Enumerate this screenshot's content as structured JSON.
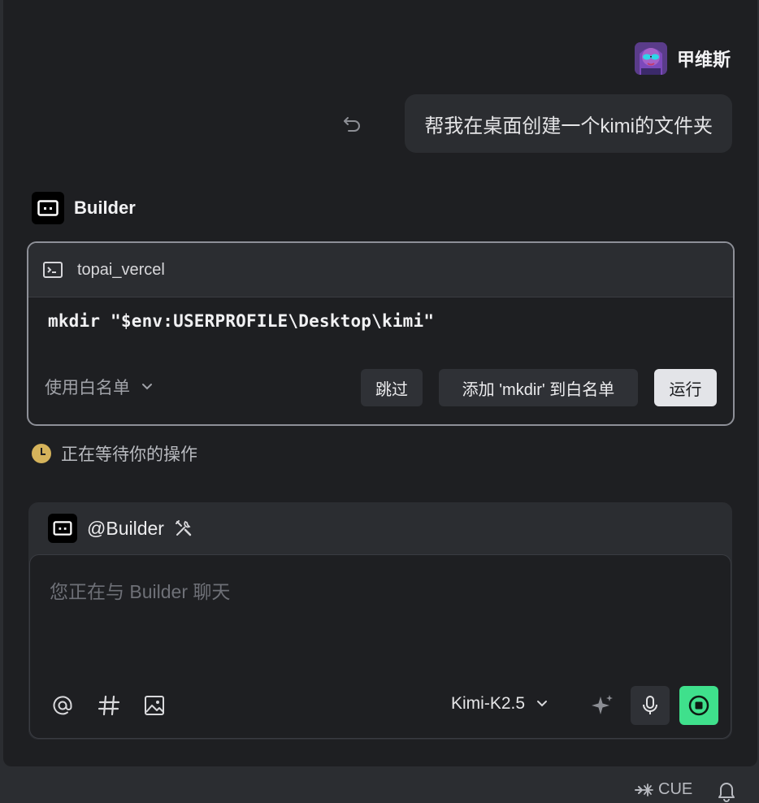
{
  "user": {
    "name": "甲维斯",
    "message": "帮我在桌面创建一个kimi的文件夹"
  },
  "assistant": {
    "name": "Builder"
  },
  "command_card": {
    "tool_name": "topai_vercel",
    "command": "mkdir \"$env:USERPROFILE\\Desktop\\kimi\"",
    "whitelist_select": "使用白名单",
    "skip_label": "跳过",
    "add_whitelist_label": "添加 'mkdir' 到白名单",
    "run_label": "运行"
  },
  "status": {
    "waiting_text": "正在等待你的操作"
  },
  "composer": {
    "mention": "@Builder",
    "placeholder": "您正在与 Builder 聊天",
    "model": "Kimi-K2.5"
  },
  "statusbar": {
    "cue_label": "CUE"
  },
  "colors": {
    "background": "#1e1f22",
    "surface": "#2b2d31",
    "accent_green": "#3fe08c",
    "clock_yellow": "#d5b35b"
  }
}
